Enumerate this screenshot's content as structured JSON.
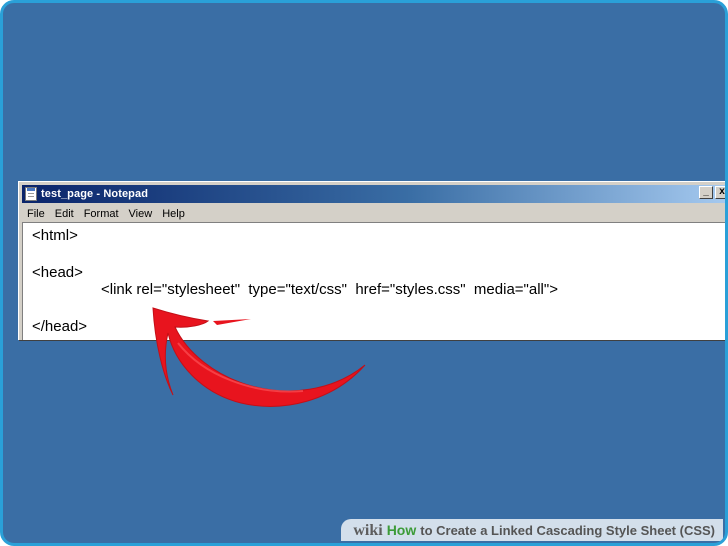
{
  "window": {
    "title": "test_page - Notepad",
    "minimize_glyph": "_",
    "close_glyph": "x"
  },
  "menu": [
    "File",
    "Edit",
    "Format",
    "View",
    "Help"
  ],
  "editor": {
    "lines": [
      "<html>",
      "<head>",
      "<link rel=\"stylesheet\"  type=\"text/css\"  href=\"styles.css\"  media=\"all\">",
      "</head>"
    ]
  },
  "watermark": {
    "wiki": "wiki",
    "how": "How",
    "title": "to Create a Linked Cascading Style Sheet (CSS)"
  },
  "colors": {
    "desktop": "#3a6ea5",
    "frame_border": "#2aa0d8",
    "arrow": "#e8141e",
    "titlebar_start": "#0a246a"
  },
  "icons": {
    "app": "notepad-icon",
    "arrow": "red-arrow-annotation"
  }
}
